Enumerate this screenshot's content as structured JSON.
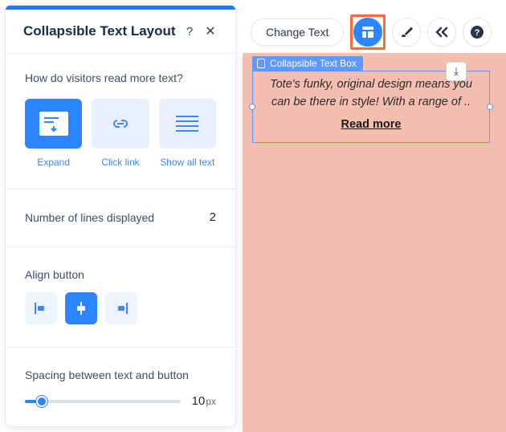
{
  "panel": {
    "title": "Collapsible Text Layout",
    "help_icon": "?",
    "close_icon": "✕",
    "read_question": "How do visitors read more text?",
    "options": {
      "expand": "Expand",
      "click_link": "Click link",
      "show_all": "Show all text"
    },
    "lines_label": "Number of lines displayed",
    "lines_value": "2",
    "align_label": "Align button",
    "spacing_label": "Spacing between text and button",
    "spacing_value": "10",
    "spacing_unit": "px"
  },
  "toolbar": {
    "change_text": "Change Text"
  },
  "canvas": {
    "badge_label": "Collapsible Text Box",
    "sample_text": "Tote's funky, original design means you can be there in style! With a range of ..",
    "read_more": "Read more",
    "download_glyph": "⤓"
  }
}
